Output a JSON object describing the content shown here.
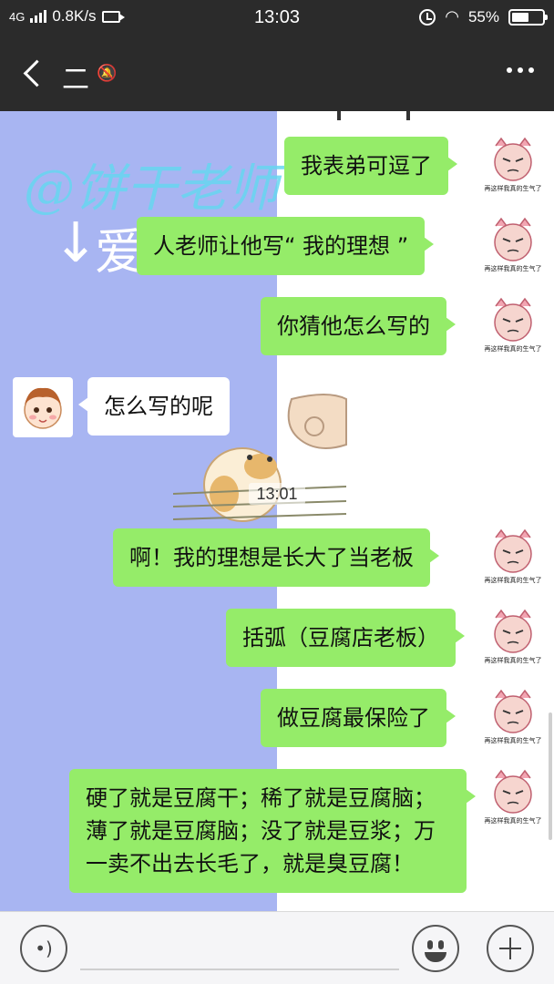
{
  "status_bar": {
    "network": "4G",
    "speed": "0.8K/s",
    "time": "13:03",
    "battery": "55%",
    "battery_level": 0.55,
    "icons": [
      "signal-icon",
      "video-icon",
      "alarm-icon",
      "wifi-icon",
      "battery-icon"
    ]
  },
  "header": {
    "title": "二",
    "muted": true,
    "icons": [
      "back-icon",
      "mute-icon",
      "more-icon"
    ]
  },
  "chat": {
    "background_text": {
      "scribble": "@饼干老师",
      "love": "爱"
    },
    "messages": [
      {
        "side": "me",
        "text": "我表弟可逗了"
      },
      {
        "side": "me",
        "text": "人老师让他写“ 我的理想 ”"
      },
      {
        "side": "me",
        "text": "你猜他怎么写的"
      },
      {
        "side": "them",
        "text": "怎么写的呢"
      },
      {
        "side": "me",
        "text": "啊！我的理想是长大了当老板"
      },
      {
        "side": "me",
        "text": "括弧（豆腐店老板）"
      },
      {
        "side": "me",
        "text": "做豆腐最保险了"
      },
      {
        "side": "me",
        "text": "硬了就是豆腐干；稀了就是豆腐脑；薄了就是豆腐脑；没了就是豆浆；万一卖不出去长毛了，就是臭豆腐！"
      }
    ],
    "time_separator": "13:01",
    "my_avatar_caption": "再这样我真的生气了"
  },
  "input_bar": {
    "placeholder": "",
    "icons": [
      "voice-icon",
      "emoji-icon",
      "plus-icon"
    ]
  },
  "colors": {
    "bar_bg": "#2b2b2b",
    "my_bubble": "#95ec69",
    "their_bubble": "#ffffff",
    "chat_bg_left": "#a8b5f2"
  }
}
